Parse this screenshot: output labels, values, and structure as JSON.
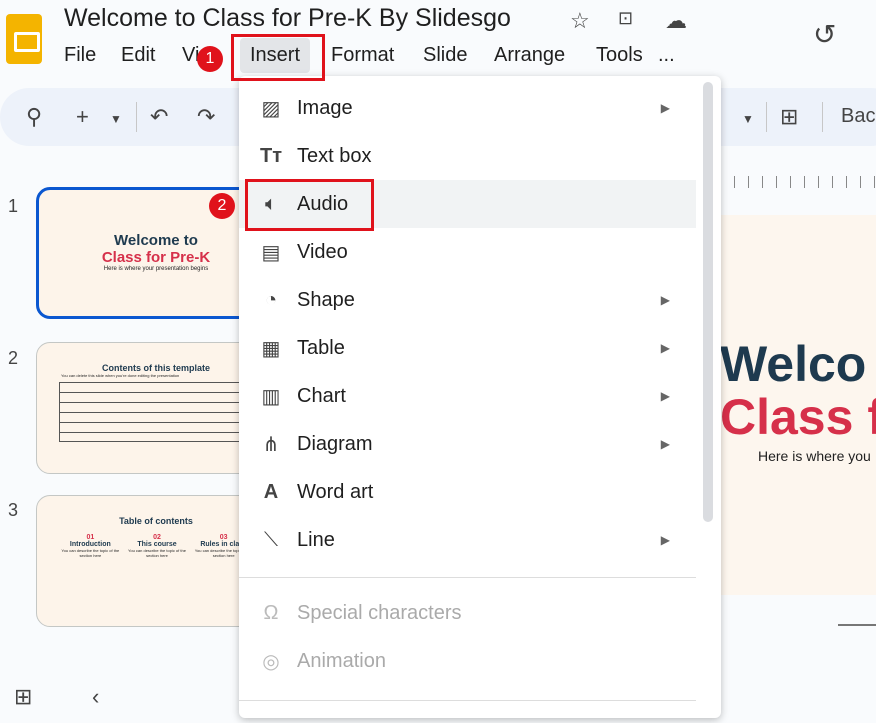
{
  "app": {
    "title": "Welcome to Class for Pre-K By Slidesgo"
  },
  "menubar": [
    "File",
    "Edit",
    "View",
    "Insert",
    "Format",
    "Slide",
    "Arrange",
    "Tools",
    "..."
  ],
  "toolbar": {
    "background_label": "Bac"
  },
  "slides": [
    {
      "number": "1",
      "title_line1": "Welcome to",
      "title_line2": "Class for Pre-K",
      "subtitle": "Here is where your presentation begins"
    },
    {
      "number": "2",
      "title": "Contents of this template",
      "subtitle": "You can delete this slide when you're done editing the presentation"
    },
    {
      "number": "3",
      "title": "Table of contents",
      "sections": [
        {
          "n": "01",
          "name": "Introduction"
        },
        {
          "n": "02",
          "name": "This course"
        },
        {
          "n": "03",
          "name": "Rules in class"
        }
      ],
      "desc": "You can describe the topic of the section here"
    }
  ],
  "canvas": {
    "line1": "Welco",
    "line2": "Class fo",
    "line3": "Here is where you"
  },
  "insert_menu": {
    "items": [
      {
        "label": "Image",
        "icon": "image-icon",
        "submenu": true
      },
      {
        "label": "Text box",
        "icon": "text-box-icon",
        "submenu": false
      },
      {
        "label": "Audio",
        "icon": "audio-icon",
        "submenu": false
      },
      {
        "label": "Video",
        "icon": "video-icon",
        "submenu": false
      },
      {
        "label": "Shape",
        "icon": "shape-icon",
        "submenu": true
      },
      {
        "label": "Table",
        "icon": "table-icon",
        "submenu": true
      },
      {
        "label": "Chart",
        "icon": "chart-icon",
        "submenu": true
      },
      {
        "label": "Diagram",
        "icon": "diagram-icon",
        "submenu": true
      },
      {
        "label": "Word art",
        "icon": "word-art-icon",
        "submenu": false
      },
      {
        "label": "Line",
        "icon": "line-icon",
        "submenu": true
      },
      {
        "label": "Special characters",
        "icon": "omega-icon",
        "disabled": true
      },
      {
        "label": "Animation",
        "icon": "animation-icon",
        "disabled": true
      }
    ]
  },
  "annotations": {
    "step1": "1",
    "step2": "2"
  },
  "colors": {
    "annotation": "#e0121b",
    "selection": "#0b57d0",
    "navy": "#1e3a4f",
    "red": "#d6304a"
  }
}
